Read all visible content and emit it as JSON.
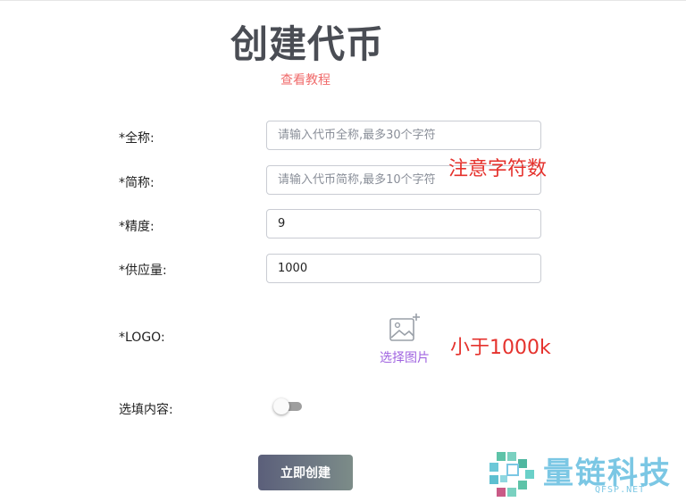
{
  "page": {
    "title": "创建代币",
    "tutorial_link": "查看教程"
  },
  "form": {
    "full_name": {
      "label": "*全称:",
      "placeholder": "请输入代币全称,最多30个字符",
      "value": ""
    },
    "short_name": {
      "label": "*简称:",
      "placeholder": "请输入代币简称,最多10个字符",
      "value": ""
    },
    "precision": {
      "label": "*精度:",
      "value": "9"
    },
    "supply": {
      "label": "*供应量:",
      "value": "1000"
    },
    "logo": {
      "label": "*LOGO:",
      "upload_label": "选择图片",
      "icon": "image-add-icon"
    },
    "optional": {
      "label": "选填内容:",
      "toggle_on": false
    },
    "submit_label": "立即创建"
  },
  "annotations": {
    "char_count_note": "注意字符数",
    "size_note": "小于1000k",
    "color": "#e5322d"
  },
  "watermark": {
    "name": "量链科技",
    "site": "QFSP.NET",
    "color": "#7bc7e4"
  },
  "colors": {
    "title": "#4a4d54",
    "tutorial_link": "#f06b6b",
    "upload_label": "#a064e0"
  }
}
